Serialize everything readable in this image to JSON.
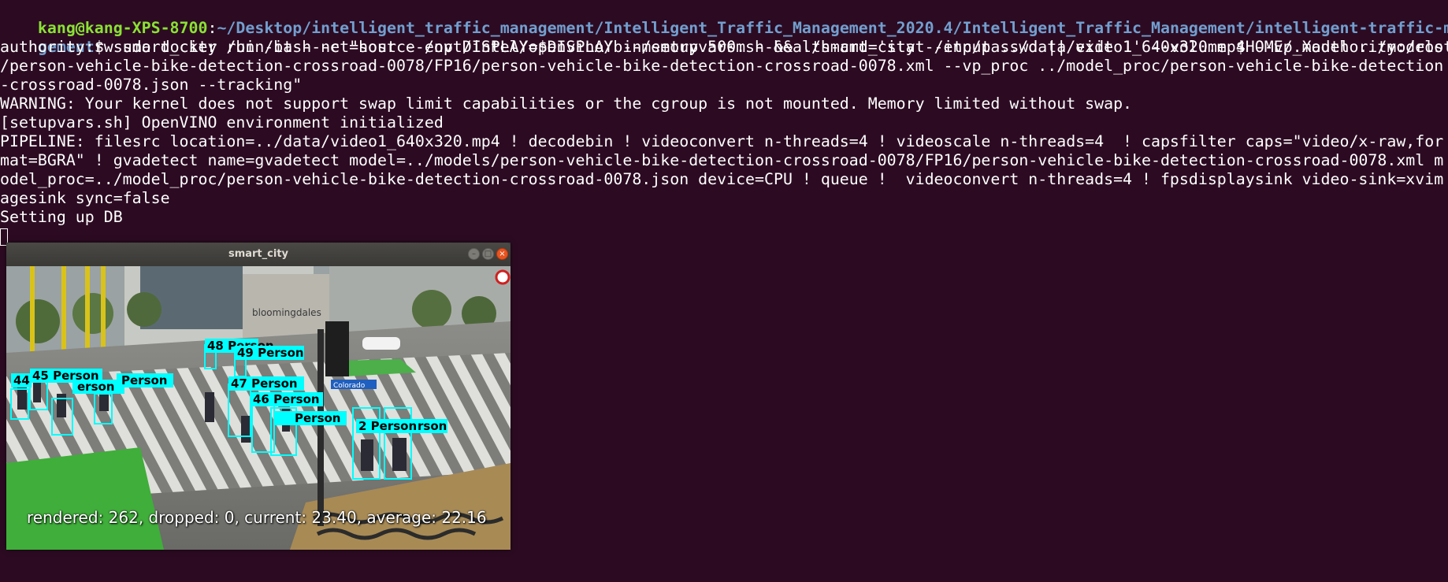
{
  "terminal": {
    "prompt_user_host": "kang@kang-XPS-8700",
    "prompt_separator": ":",
    "prompt_path_part1": "~/Desktop/intelligent_traffic_management/Intelligent_Traffic_Management_2020.4/Intelligent_Traffic_Management/intelligent-traffic-mana",
    "prompt_path_part2": "gement",
    "prompt_symbol": "$",
    "command_part1": " sudo docker run -it --net=host --env DISPLAY=$DISPLAY --memory 500m --health-cmd='stat /etc/passwd || exit 1' --volume $HOME/.Xauthority:/root/.X",
    "lines": [
      "authority:rw smart_city /bin/bash -c \"source /opt/intel/openvino/bin/setupvars.sh && ./smart_city --input ../data/video1_640x320.mp4 --vp_model ../models",
      "/person-vehicle-bike-detection-crossroad-0078/FP16/person-vehicle-bike-detection-crossroad-0078.xml --vp_proc ../model_proc/person-vehicle-bike-detection",
      "-crossroad-0078.json --tracking\"",
      "WARNING: Your kernel does not support swap limit capabilities or the cgroup is not mounted. Memory limited without swap.",
      "[setupvars.sh] OpenVINO environment initialized",
      "PIPELINE: filesrc location=../data/video1_640x320.mp4 ! decodebin ! videoconvert n-threads=4 ! videoscale n-threads=4  ! capsfilter caps=\"video/x-raw,for",
      "mat=BGRA\" ! gvadetect name=gvadetect model=../models/person-vehicle-bike-detection-crossroad-0078/FP16/person-vehicle-bike-detection-crossroad-0078.xml m",
      "odel_proc=../model_proc/person-vehicle-bike-detection-crossroad-0078.json device=CPU ! queue !  videoconvert n-threads=4 ! fpsdisplaysink video-sink=xvim",
      "agesink sync=false",
      "Setting up DB"
    ]
  },
  "window": {
    "title": "smart_city",
    "minimize_glyph": "–",
    "maximize_glyph": "□",
    "close_glyph": "×",
    "fps_text": "rendered: 262, dropped: 0, current: 23.40, average: 22.16",
    "street_sign": "Colorado",
    "store_sign": "bloomingdales",
    "detections": [
      {
        "label": "48 Person"
      },
      {
        "label": "49 Person"
      },
      {
        "label": "45 Person"
      },
      {
        "label": "44"
      },
      {
        "label": "erson"
      },
      {
        "label": "Person"
      },
      {
        "label": "47 Person"
      },
      {
        "label": "46 Person"
      },
      {
        "label": "Person"
      },
      {
        "label": "2 Person"
      },
      {
        "label": "rson"
      }
    ]
  },
  "colors": {
    "background": "#2c0b22",
    "prompt_user": "#8ae234",
    "prompt_path": "#729fcf",
    "detection_box": "#00ffff"
  }
}
